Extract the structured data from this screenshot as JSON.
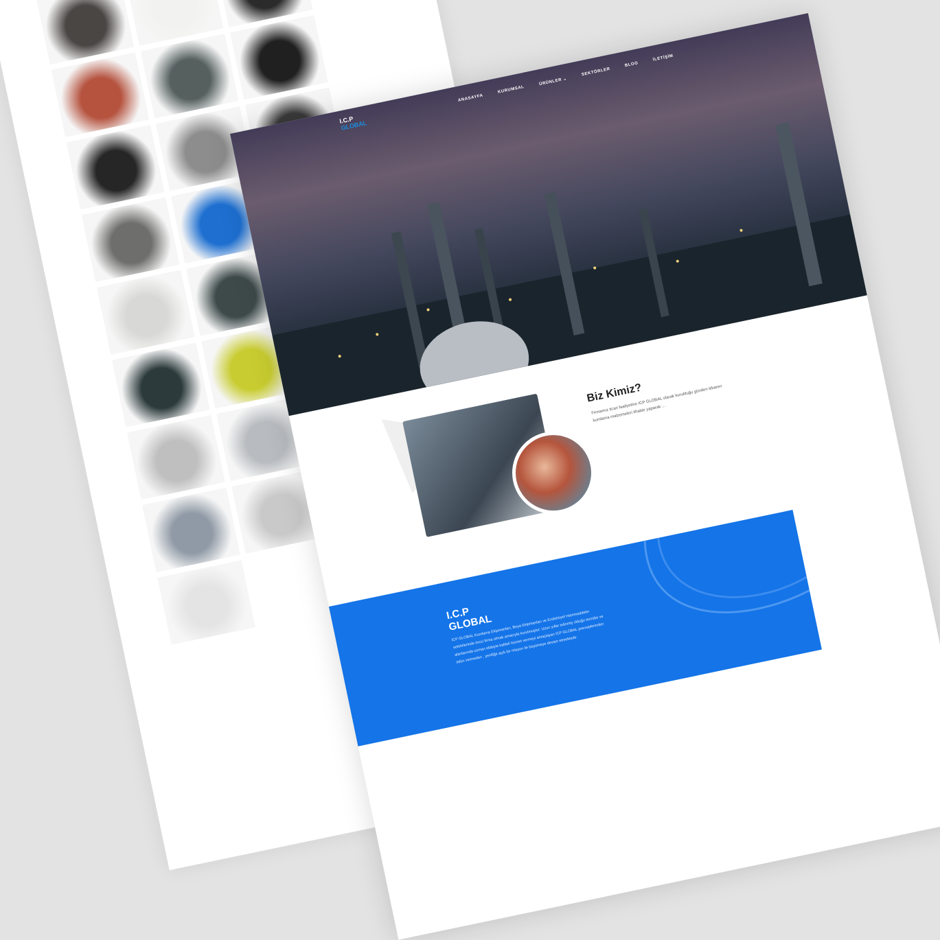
{
  "product_tiles": [
    "#4a4644",
    "#f2f2f0",
    "#2b2b2b",
    "#b5533f",
    "#55605f",
    "#202020",
    "#262626",
    "#8d8d8d",
    "#3a3a3a",
    "#6e6e6c",
    "#1e6fd0",
    "#dfe0e2",
    "#d8d8d6",
    "#3e4a4a",
    "#f4f4f4",
    "#2c3a3c",
    "#c8cc30",
    "#3a3a3a",
    "#bfbfbf",
    "#b8bcc0",
    "#e2e2e2",
    "#909aa6",
    "#c9c9c9",
    "#8aa0b8",
    "#e4e4e4"
  ],
  "nav": {
    "logo_top": "I.C.P",
    "logo_bottom": "GLOBAL",
    "items": [
      "ANASAYFA",
      "KURUMSAL",
      "ÜRÜNLER ⌄",
      "SEKTÖRLER",
      "BLOG",
      "İLETİŞİM"
    ]
  },
  "about": {
    "title": "Biz Kimiz?",
    "text": "Firmamız ticari faaliyetine ICP GLOBAL olarak kurulduğu günden itibaren kumlama malzemeleri ithalatı yaparak ..."
  },
  "footer_band": {
    "title_line1": "I.C.P",
    "title_line2": "GLOBAL",
    "text": "ICP GLOBAL Kumlama Ekipmanları, Boya Ekipmanları ve Endstrüyel Hammaddeler sektörlerinde öncü firma olmak amacıyla kurulmuştur. Uzun yıllar edinmiş olduğu tecrübe ve alanlarında uzman ekibiyle kaliteli hizmet vermeyi amaçlayan ICP GLOBAL prensiplerinden ödün vermeden , yeniliğe açık bir misyon ile büyümeye devam etmektedir.",
    "color": "#1474e8"
  }
}
